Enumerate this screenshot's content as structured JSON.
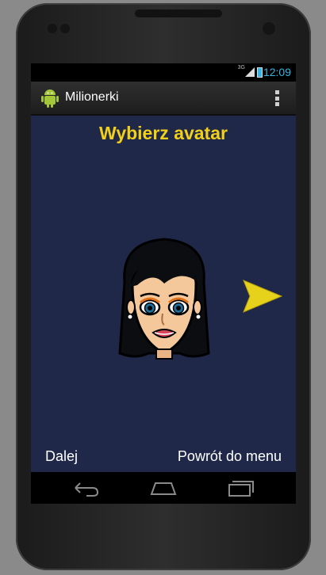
{
  "status_bar": {
    "network": "3G",
    "time": "12:09"
  },
  "action_bar": {
    "app_title": "Milionerki",
    "app_icon": "android-icon",
    "menu_icon": "overflow-menu-icon"
  },
  "screen": {
    "title": "Wybierz avatar",
    "avatar_icon": "avatar-woman-icon",
    "next_icon": "next-arrow-icon",
    "next_button": "Dalej",
    "menu_button": "Powrót do menu"
  },
  "nav_bar": {
    "back_icon": "back-icon",
    "home_icon": "home-icon",
    "recents_icon": "recent-apps-icon"
  },
  "colors": {
    "background": "#1f2848",
    "accent": "#f2d01a",
    "clock": "#33b5e5"
  }
}
